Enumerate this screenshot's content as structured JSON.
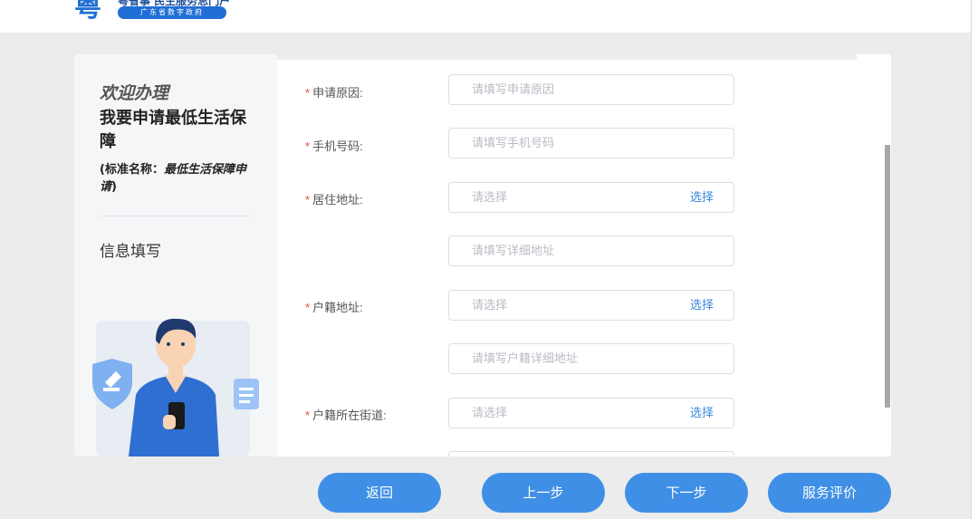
{
  "header": {
    "logo_mark": "粤",
    "logo_name": "粤省事 民生服务总门户",
    "logo_badge": "广东省数字政府"
  },
  "left": {
    "welcome": "欢迎办理",
    "service_title": "我要申请最低生活保障",
    "std_prefix": "(标准名称：",
    "std_name": "最低生活保障申请",
    "std_suffix": ")",
    "step": "信息填写"
  },
  "form": {
    "required_mark": "*",
    "fields": [
      {
        "label": "申请原因:",
        "placeholder": "请填写申请原因"
      },
      {
        "label": "手机号码:",
        "placeholder": "请填写手机号码"
      },
      {
        "label": "居住地址:",
        "placeholder": "请选择",
        "action": "选择"
      },
      {
        "label": "",
        "placeholder": "请填写详细地址"
      },
      {
        "label": "户籍地址:",
        "placeholder": "请选择",
        "action": "选择"
      },
      {
        "label": "",
        "placeholder": "请填写户籍详细地址"
      },
      {
        "label": "户籍所在街道:",
        "placeholder": "请选择",
        "action": "选择"
      }
    ]
  },
  "buttons": {
    "back": "返回",
    "prev": "上一步",
    "next": "下一步",
    "rate": "服务评价"
  },
  "colors": {
    "accent": "#3f8fe6",
    "required": "#e84c3d",
    "link": "#3a87d9"
  }
}
